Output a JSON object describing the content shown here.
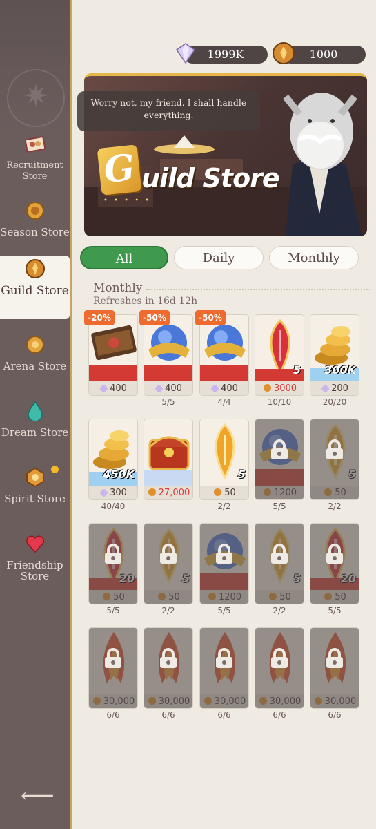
{
  "currency": {
    "gems": "1999K",
    "guild_coins": "1000"
  },
  "sidebar": {
    "items": [
      {
        "label": "Recruitment Store",
        "icon": "ticket-icon"
      },
      {
        "label": "Season Store",
        "icon": "season-coin-icon"
      },
      {
        "label": "Guild Store",
        "icon": "guild-coin-icon"
      },
      {
        "label": "Arena Store",
        "icon": "arena-coin-icon"
      },
      {
        "label": "Dream Store",
        "icon": "dream-drop-icon"
      },
      {
        "label": "Spirit Store",
        "icon": "spirit-coin-icon"
      },
      {
        "label": "Friendship Store",
        "icon": "heart-icon"
      }
    ],
    "active": "Guild Store",
    "back_icon": "back-arrow-icon"
  },
  "banner": {
    "speech": "Worry not, my friend. I shall handle everything.",
    "logo_letter": "G",
    "title": "uild Store"
  },
  "tabs": [
    {
      "label": "All",
      "selected": true
    },
    {
      "label": "Daily",
      "selected": false
    },
    {
      "label": "Monthly",
      "selected": false
    }
  ],
  "section": {
    "title": "Monthly",
    "refresh": "Refreshes in 16d 12h"
  },
  "items": [
    {
      "discount": "-20%",
      "price": "400",
      "currency": "gem",
      "limit": "",
      "qty": "",
      "art": "scroll",
      "locked": false
    },
    {
      "discount": "-50%",
      "price": "400",
      "currency": "gem",
      "limit": "5/5",
      "qty": "",
      "art": "orb",
      "locked": false
    },
    {
      "discount": "-50%",
      "price": "400",
      "currency": "gem",
      "limit": "4/4",
      "qty": "",
      "art": "orb",
      "locked": false
    },
    {
      "discount": "",
      "price": "3000",
      "currency": "coin",
      "limit": "10/10",
      "qty": "5",
      "art": "red-shard",
      "locked": false,
      "price_red": true
    },
    {
      "discount": "",
      "price": "200",
      "currency": "gem",
      "limit": "20/20",
      "qty": "300K",
      "art": "gold",
      "locked": false
    },
    {
      "discount": "",
      "price": "300",
      "currency": "gem",
      "limit": "40/40",
      "qty": "450K",
      "art": "gold",
      "locked": false
    },
    {
      "discount": "",
      "price": "27,000",
      "currency": "coin",
      "limit": "",
      "qty": "",
      "art": "chest",
      "locked": false,
      "price_red": true
    },
    {
      "discount": "",
      "price": "50",
      "currency": "coin",
      "limit": "2/2",
      "qty": "5",
      "art": "gold-shard",
      "locked": false
    },
    {
      "discount": "",
      "price": "1200",
      "currency": "coin",
      "limit": "5/5",
      "qty": "",
      "art": "orb",
      "locked": true
    },
    {
      "discount": "",
      "price": "50",
      "currency": "coin",
      "limit": "2/2",
      "qty": "5",
      "art": "gold-shard",
      "locked": true
    },
    {
      "discount": "",
      "price": "50",
      "currency": "coin",
      "limit": "5/5",
      "qty": "20",
      "art": "red-shard",
      "locked": true
    },
    {
      "discount": "",
      "price": "50",
      "currency": "coin",
      "limit": "2/2",
      "qty": "5",
      "art": "gold-shard",
      "locked": true
    },
    {
      "discount": "",
      "price": "1200",
      "currency": "coin",
      "limit": "5/5",
      "qty": "",
      "art": "orb",
      "locked": true
    },
    {
      "discount": "",
      "price": "50",
      "currency": "coin",
      "limit": "2/2",
      "qty": "5",
      "art": "gold-shard",
      "locked": true
    },
    {
      "discount": "",
      "price": "50",
      "currency": "coin",
      "limit": "5/5",
      "qty": "20",
      "art": "red-shard",
      "locked": true
    },
    {
      "discount": "",
      "price": "30,000",
      "currency": "coin",
      "limit": "6/6",
      "qty": "",
      "art": "flame",
      "locked": true
    },
    {
      "discount": "",
      "price": "30,000",
      "currency": "coin",
      "limit": "6/6",
      "qty": "",
      "art": "flame",
      "locked": true
    },
    {
      "discount": "",
      "price": "30,000",
      "currency": "coin",
      "limit": "6/6",
      "qty": "",
      "art": "flame",
      "locked": true
    },
    {
      "discount": "",
      "price": "30,000",
      "currency": "coin",
      "limit": "6/6",
      "qty": "",
      "art": "flame",
      "locked": true
    },
    {
      "discount": "",
      "price": "30,000",
      "currency": "coin",
      "limit": "6/6",
      "qty": "",
      "art": "flame",
      "locked": true
    }
  ],
  "colors": {
    "accent_green": "#3f9a4e",
    "sidebar": "#6b5d5c",
    "gold": "#e7b64a",
    "discount": "#ee6a2e"
  }
}
